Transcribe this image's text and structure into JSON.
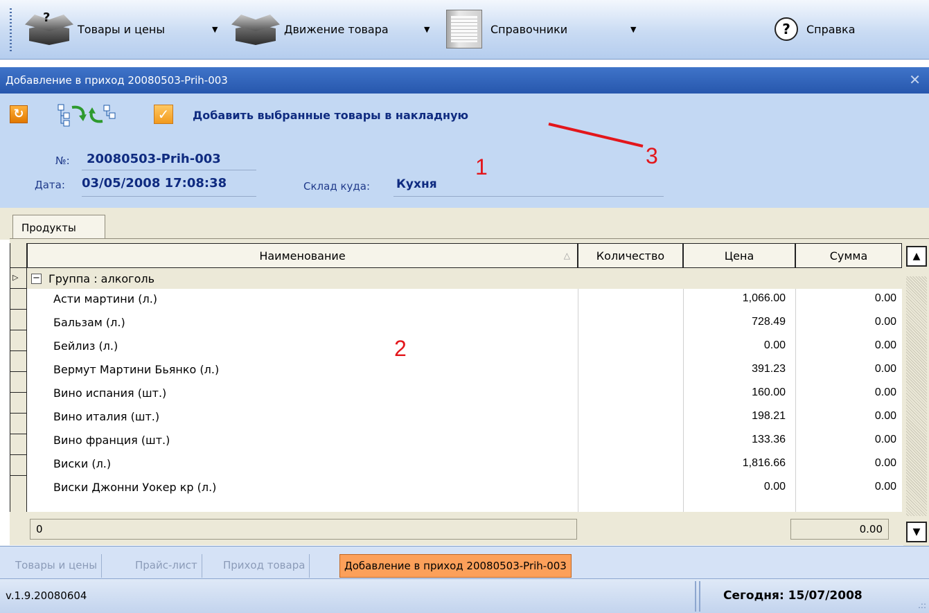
{
  "menu": {
    "items": [
      {
        "label": "Товары и цены",
        "icon": "box-icon"
      },
      {
        "label": "Движение товара",
        "icon": "box-icon"
      },
      {
        "label": "Справочники",
        "icon": "book-icon"
      },
      {
        "label": "Справка",
        "icon": "help-icon"
      }
    ]
  },
  "window": {
    "title": "Добавление в приход 20080503-Prih-003"
  },
  "toolbar": {
    "add_label": "Добавить выбранные товары в накладную"
  },
  "doc": {
    "no_label": "№:",
    "no_value": "20080503-Prih-003",
    "date_label": "Дата:",
    "date_value": "03/05/2008 17:08:38",
    "warehouse_label": "Склад куда:",
    "warehouse_value": "Кухня"
  },
  "annotations": [
    "1",
    "2",
    "3"
  ],
  "tab": {
    "label": "Продукты"
  },
  "grid": {
    "headers": {
      "name": "Наименование",
      "qty": "Количество",
      "price": "Цена",
      "sum": "Сумма"
    },
    "group": "Группа : алкоголь",
    "rows": [
      {
        "name": "Асти мартини (л.)",
        "price": "1,066.00",
        "sum": "0.00"
      },
      {
        "name": "Бальзам (л.)",
        "price": "728.49",
        "sum": "0.00"
      },
      {
        "name": "Бейлиз (л.)",
        "price": "0.00",
        "sum": "0.00"
      },
      {
        "name": "Вермут Мартини Бьянко (л.)",
        "price": "391.23",
        "sum": "0.00"
      },
      {
        "name": "Вино испания (шт.)",
        "price": "160.00",
        "sum": "0.00"
      },
      {
        "name": "Вино италия (шт.)",
        "price": "198.21",
        "sum": "0.00"
      },
      {
        "name": "Вино франция (шт.)",
        "price": "133.36",
        "sum": "0.00"
      },
      {
        "name": "Виски (л.)",
        "price": "1,816.66",
        "sum": "0.00"
      },
      {
        "name": "Виски Джонни Уокер кр (л.)",
        "price": "0.00",
        "sum": "0.00"
      }
    ],
    "footer_count": "0",
    "footer_sum": "0.00"
  },
  "window_tabs": [
    {
      "label": "Товары и цены",
      "active": false
    },
    {
      "label": "Прайс-лист",
      "active": false
    },
    {
      "label": "Приход товара",
      "active": false
    },
    {
      "label": "Добавление в приход 20080503-Prih-003",
      "active": true
    }
  ],
  "status": {
    "version": "v.1.9.20080604",
    "today": "Сегодня: 15/07/2008"
  },
  "colors": {
    "title_bar": "#2d61b7",
    "header_bg": "#c3d8f3",
    "active_tab": "#fca05a",
    "annotation": "#e3161b"
  }
}
